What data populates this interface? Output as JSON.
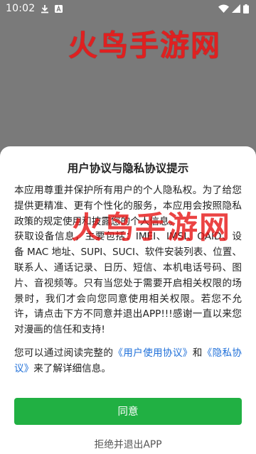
{
  "status_bar": {
    "time": "10:02",
    "icons": [
      "download-icon",
      "text-a-icon",
      "wifi-icon",
      "cellular-icon",
      "battery-icon"
    ]
  },
  "watermark": {
    "text": "火鸟手游网"
  },
  "dialog": {
    "title": "用户协议与隐私协议提示",
    "paragraphs": [
      "本应用尊重并保护所有用户的个人隐私权。为了给您提供更精准、更有个性化的服务，本应用会按照隐私政策的规定使用和披露您的个人信息。",
      "获取设备信息，主要包括：IMEI、IMSI、OAID、设备 MAC 地址、SUPI、SUCI、软件安装列表、位置、联系人、通话记录、日历、短信、本机电话号码、图片、音视频等。只有当您处于需要开启相关权限的场景时，我们才会向您同意使用相关权限。若您不允许，请点击下方不同意并退出APP!!!感谢一直以来您对漫画的信任和支持!"
    ],
    "links_sentence": {
      "prefix": "您可以通过阅读完整的",
      "user_agreement": "《用户使用协议》",
      "conjunction": "和",
      "privacy_agreement": "《隐私协议》",
      "suffix": "来了解详细信息。"
    },
    "agree_label": "同意",
    "reject_label": "拒绝并退出APP"
  },
  "colors": {
    "overlay": "#7a7a7a",
    "accent_green": "#21b043",
    "link_blue": "#1e6fd9",
    "watermark_red": "#e02020"
  }
}
